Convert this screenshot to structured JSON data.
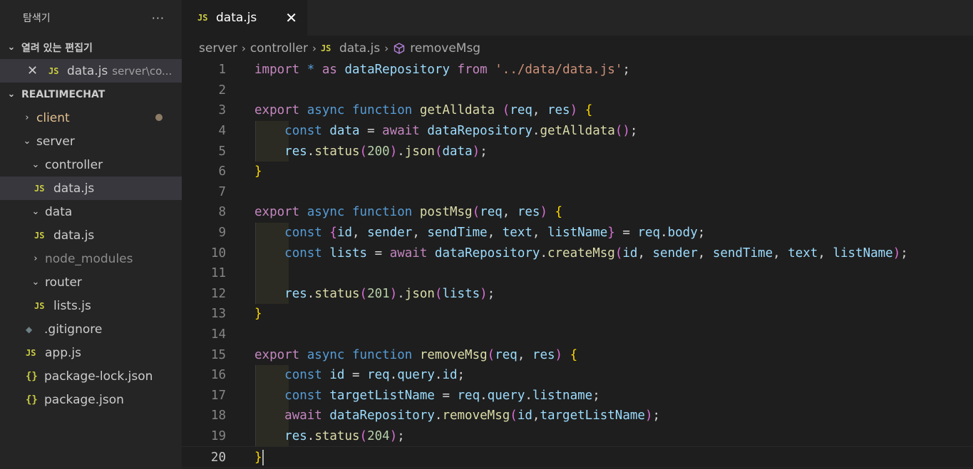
{
  "explorer": {
    "title": "탐색기",
    "more": "···",
    "open_editors_label": "열려 있는 편집기",
    "open_editor": {
      "close": "✕",
      "badge": "JS",
      "name": "data.js",
      "desc": "server\\co..."
    },
    "project_label": "REALTIMECHAT",
    "tree": [
      {
        "name": "client",
        "type": "folder",
        "chev": "›",
        "depth": 1,
        "modified": true
      },
      {
        "name": "server",
        "type": "folder",
        "chev": "⌄",
        "depth": 1
      },
      {
        "name": "controller",
        "type": "folder",
        "chev": "⌄",
        "depth": 2
      },
      {
        "name": "data.js",
        "type": "js",
        "depth": 3,
        "active": true
      },
      {
        "name": "data",
        "type": "folder",
        "chev": "⌄",
        "depth": 2
      },
      {
        "name": "data.js",
        "type": "js",
        "depth": 3
      },
      {
        "name": "node_modules",
        "type": "folder",
        "chev": "›",
        "depth": 2,
        "dim": true
      },
      {
        "name": "router",
        "type": "folder",
        "chev": "⌄",
        "depth": 2
      },
      {
        "name": "lists.js",
        "type": "js",
        "depth": 3
      },
      {
        "name": ".gitignore",
        "type": "git",
        "depth": 2
      },
      {
        "name": "app.js",
        "type": "js",
        "depth": 2
      },
      {
        "name": "package-lock.json",
        "type": "json",
        "depth": 2
      },
      {
        "name": "package.json",
        "type": "json",
        "depth": 2
      }
    ]
  },
  "tab": {
    "badge": "JS",
    "name": "data.js",
    "close": "✕"
  },
  "breadcrumb": {
    "items": [
      "server",
      "controller"
    ],
    "file_badge": "JS",
    "file": "data.js",
    "symbol": "removeMsg",
    "sep": "›"
  },
  "colors": {
    "keyword": "#569cd6",
    "control": "#c586c0",
    "function": "#dcdcaa",
    "variable": "#9cdcfe",
    "string": "#ce9178",
    "number": "#b5cea8",
    "bracket1": "#ffd700",
    "bracket2": "#da70d6",
    "bracket3": "#179fff",
    "punct": "#d4d4d4"
  },
  "code": [
    {
      "n": "1",
      "tokens": [
        [
          "import",
          "control"
        ],
        [
          " ",
          ""
        ],
        [
          "*",
          "keyword"
        ],
        [
          " ",
          ""
        ],
        [
          "as",
          "control"
        ],
        [
          " ",
          ""
        ],
        [
          "dataRepository",
          "variable"
        ],
        [
          " ",
          ""
        ],
        [
          "from",
          "control"
        ],
        [
          " ",
          ""
        ],
        [
          "'../data/data.js'",
          "string"
        ],
        [
          ";",
          "punct"
        ]
      ]
    },
    {
      "n": "2",
      "tokens": []
    },
    {
      "n": "3",
      "tokens": [
        [
          "export",
          "control"
        ],
        [
          " ",
          ""
        ],
        [
          "async",
          "keyword"
        ],
        [
          " ",
          ""
        ],
        [
          "function",
          "keyword"
        ],
        [
          " ",
          ""
        ],
        [
          "getAlldata",
          "function"
        ],
        [
          " ",
          ""
        ],
        [
          "(",
          "bracket2"
        ],
        [
          "req",
          "variable"
        ],
        [
          ", ",
          "punct"
        ],
        [
          "res",
          "variable"
        ],
        [
          ")",
          "bracket2"
        ],
        [
          " ",
          ""
        ],
        [
          "{",
          "bracket1"
        ]
      ]
    },
    {
      "n": "4",
      "indent": true,
      "tokens": [
        [
          "    ",
          ""
        ],
        [
          "const",
          "keyword"
        ],
        [
          " ",
          ""
        ],
        [
          "data",
          "variable"
        ],
        [
          " = ",
          "punct"
        ],
        [
          "await",
          "control"
        ],
        [
          " ",
          ""
        ],
        [
          "dataRepository",
          "variable"
        ],
        [
          ".",
          "punct"
        ],
        [
          "getAlldata",
          "function"
        ],
        [
          "(",
          "bracket2"
        ],
        [
          ")",
          "bracket2"
        ],
        [
          ";",
          "punct"
        ]
      ]
    },
    {
      "n": "5",
      "indent": true,
      "tokens": [
        [
          "    ",
          ""
        ],
        [
          "res",
          "variable"
        ],
        [
          ".",
          "punct"
        ],
        [
          "status",
          "function"
        ],
        [
          "(",
          "bracket2"
        ],
        [
          "200",
          "number"
        ],
        [
          ")",
          "bracket2"
        ],
        [
          ".",
          "punct"
        ],
        [
          "json",
          "function"
        ],
        [
          "(",
          "bracket2"
        ],
        [
          "data",
          "variable"
        ],
        [
          ")",
          "bracket2"
        ],
        [
          ";",
          "punct"
        ]
      ]
    },
    {
      "n": "6",
      "tokens": [
        [
          "}",
          "bracket1"
        ]
      ]
    },
    {
      "n": "7",
      "tokens": []
    },
    {
      "n": "8",
      "tokens": [
        [
          "export",
          "control"
        ],
        [
          " ",
          ""
        ],
        [
          "async",
          "keyword"
        ],
        [
          " ",
          ""
        ],
        [
          "function",
          "keyword"
        ],
        [
          " ",
          ""
        ],
        [
          "postMsg",
          "function"
        ],
        [
          "(",
          "bracket2"
        ],
        [
          "req",
          "variable"
        ],
        [
          ", ",
          "punct"
        ],
        [
          "res",
          "variable"
        ],
        [
          ")",
          "bracket2"
        ],
        [
          " ",
          ""
        ],
        [
          "{",
          "bracket1"
        ]
      ]
    },
    {
      "n": "9",
      "indent": true,
      "tokens": [
        [
          "    ",
          ""
        ],
        [
          "const",
          "keyword"
        ],
        [
          " ",
          ""
        ],
        [
          "{",
          "bracket2"
        ],
        [
          "id",
          "variable"
        ],
        [
          ", ",
          "punct"
        ],
        [
          "sender",
          "variable"
        ],
        [
          ", ",
          "punct"
        ],
        [
          "sendTime",
          "variable"
        ],
        [
          ", ",
          "punct"
        ],
        [
          "text",
          "variable"
        ],
        [
          ", ",
          "punct"
        ],
        [
          "listName",
          "variable"
        ],
        [
          "}",
          "bracket2"
        ],
        [
          " = ",
          "punct"
        ],
        [
          "req",
          "variable"
        ],
        [
          ".",
          "punct"
        ],
        [
          "body",
          "variable"
        ],
        [
          ";",
          "punct"
        ]
      ]
    },
    {
      "n": "10",
      "indent": true,
      "tokens": [
        [
          "    ",
          ""
        ],
        [
          "const",
          "keyword"
        ],
        [
          " ",
          ""
        ],
        [
          "lists",
          "variable"
        ],
        [
          " = ",
          "punct"
        ],
        [
          "await",
          "control"
        ],
        [
          " ",
          ""
        ],
        [
          "dataRepository",
          "variable"
        ],
        [
          ".",
          "punct"
        ],
        [
          "createMsg",
          "function"
        ],
        [
          "(",
          "bracket2"
        ],
        [
          "id",
          "variable"
        ],
        [
          ", ",
          "punct"
        ],
        [
          "sender",
          "variable"
        ],
        [
          ", ",
          "punct"
        ],
        [
          "sendTime",
          "variable"
        ],
        [
          ", ",
          "punct"
        ],
        [
          "text",
          "variable"
        ],
        [
          ", ",
          "punct"
        ],
        [
          "listName",
          "variable"
        ],
        [
          ")",
          "bracket2"
        ],
        [
          ";",
          "punct"
        ]
      ]
    },
    {
      "n": "11",
      "indent": true,
      "tokens": []
    },
    {
      "n": "12",
      "indent": true,
      "tokens": [
        [
          "    ",
          ""
        ],
        [
          "res",
          "variable"
        ],
        [
          ".",
          "punct"
        ],
        [
          "status",
          "function"
        ],
        [
          "(",
          "bracket2"
        ],
        [
          "201",
          "number"
        ],
        [
          ")",
          "bracket2"
        ],
        [
          ".",
          "punct"
        ],
        [
          "json",
          "function"
        ],
        [
          "(",
          "bracket2"
        ],
        [
          "lists",
          "variable"
        ],
        [
          ")",
          "bracket2"
        ],
        [
          ";",
          "punct"
        ]
      ]
    },
    {
      "n": "13",
      "tokens": [
        [
          "}",
          "bracket1"
        ]
      ]
    },
    {
      "n": "14",
      "tokens": []
    },
    {
      "n": "15",
      "tokens": [
        [
          "export",
          "control"
        ],
        [
          " ",
          ""
        ],
        [
          "async",
          "keyword"
        ],
        [
          " ",
          ""
        ],
        [
          "function",
          "keyword"
        ],
        [
          " ",
          ""
        ],
        [
          "removeMsg",
          "function"
        ],
        [
          "(",
          "bracket2"
        ],
        [
          "req",
          "variable"
        ],
        [
          ", ",
          "punct"
        ],
        [
          "res",
          "variable"
        ],
        [
          ")",
          "bracket2"
        ],
        [
          " ",
          ""
        ],
        [
          "{",
          "bracket1"
        ]
      ]
    },
    {
      "n": "16",
      "indent": true,
      "tokens": [
        [
          "    ",
          ""
        ],
        [
          "const",
          "keyword"
        ],
        [
          " ",
          ""
        ],
        [
          "id",
          "variable"
        ],
        [
          " = ",
          "punct"
        ],
        [
          "req",
          "variable"
        ],
        [
          ".",
          "punct"
        ],
        [
          "query",
          "variable"
        ],
        [
          ".",
          "punct"
        ],
        [
          "id",
          "variable"
        ],
        [
          ";",
          "punct"
        ]
      ]
    },
    {
      "n": "17",
      "indent": true,
      "tokens": [
        [
          "    ",
          ""
        ],
        [
          "const",
          "keyword"
        ],
        [
          " ",
          ""
        ],
        [
          "targetListName",
          "variable"
        ],
        [
          " = ",
          "punct"
        ],
        [
          "req",
          "variable"
        ],
        [
          ".",
          "punct"
        ],
        [
          "query",
          "variable"
        ],
        [
          ".",
          "punct"
        ],
        [
          "listname",
          "variable"
        ],
        [
          ";",
          "punct"
        ]
      ]
    },
    {
      "n": "18",
      "indent": true,
      "tokens": [
        [
          "    ",
          ""
        ],
        [
          "await",
          "control"
        ],
        [
          " ",
          ""
        ],
        [
          "dataRepository",
          "variable"
        ],
        [
          ".",
          "punct"
        ],
        [
          "removeMsg",
          "function"
        ],
        [
          "(",
          "bracket2"
        ],
        [
          "id",
          "variable"
        ],
        [
          ",",
          "punct"
        ],
        [
          "targetListName",
          "variable"
        ],
        [
          ")",
          "bracket2"
        ],
        [
          ";",
          "punct"
        ]
      ]
    },
    {
      "n": "19",
      "indent": true,
      "tokens": [
        [
          "    ",
          ""
        ],
        [
          "res",
          "variable"
        ],
        [
          ".",
          "punct"
        ],
        [
          "status",
          "function"
        ],
        [
          "(",
          "bracket2"
        ],
        [
          "204",
          "number"
        ],
        [
          ")",
          "bracket2"
        ],
        [
          ";",
          "punct"
        ]
      ]
    },
    {
      "n": "20",
      "current": true,
      "tokens": [
        [
          "}",
          "bracket1"
        ]
      ]
    }
  ]
}
